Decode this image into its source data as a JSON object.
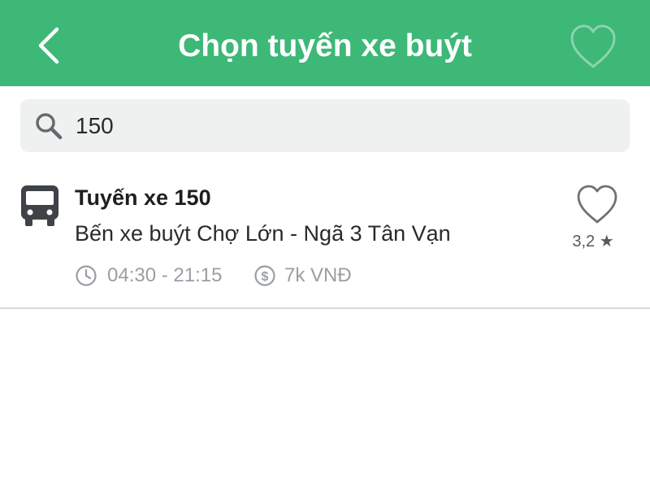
{
  "header": {
    "title": "Chọn tuyến xe buýt",
    "background_color": "#3db877",
    "back_icon": "chevron-left-icon",
    "favorite_icon": "heart-outline-icon"
  },
  "search": {
    "value": "150",
    "placeholder": "",
    "icon": "search-icon"
  },
  "routes": [
    {
      "name": "Tuyến xe 150",
      "stops": "Bến xe buýt Chợ Lớn - Ngã 3 Tân Vạn",
      "hours": "04:30 - 21:15",
      "fare": "7k VNĐ",
      "rating": "3,2 ★",
      "icon": "bus-icon"
    }
  ]
}
